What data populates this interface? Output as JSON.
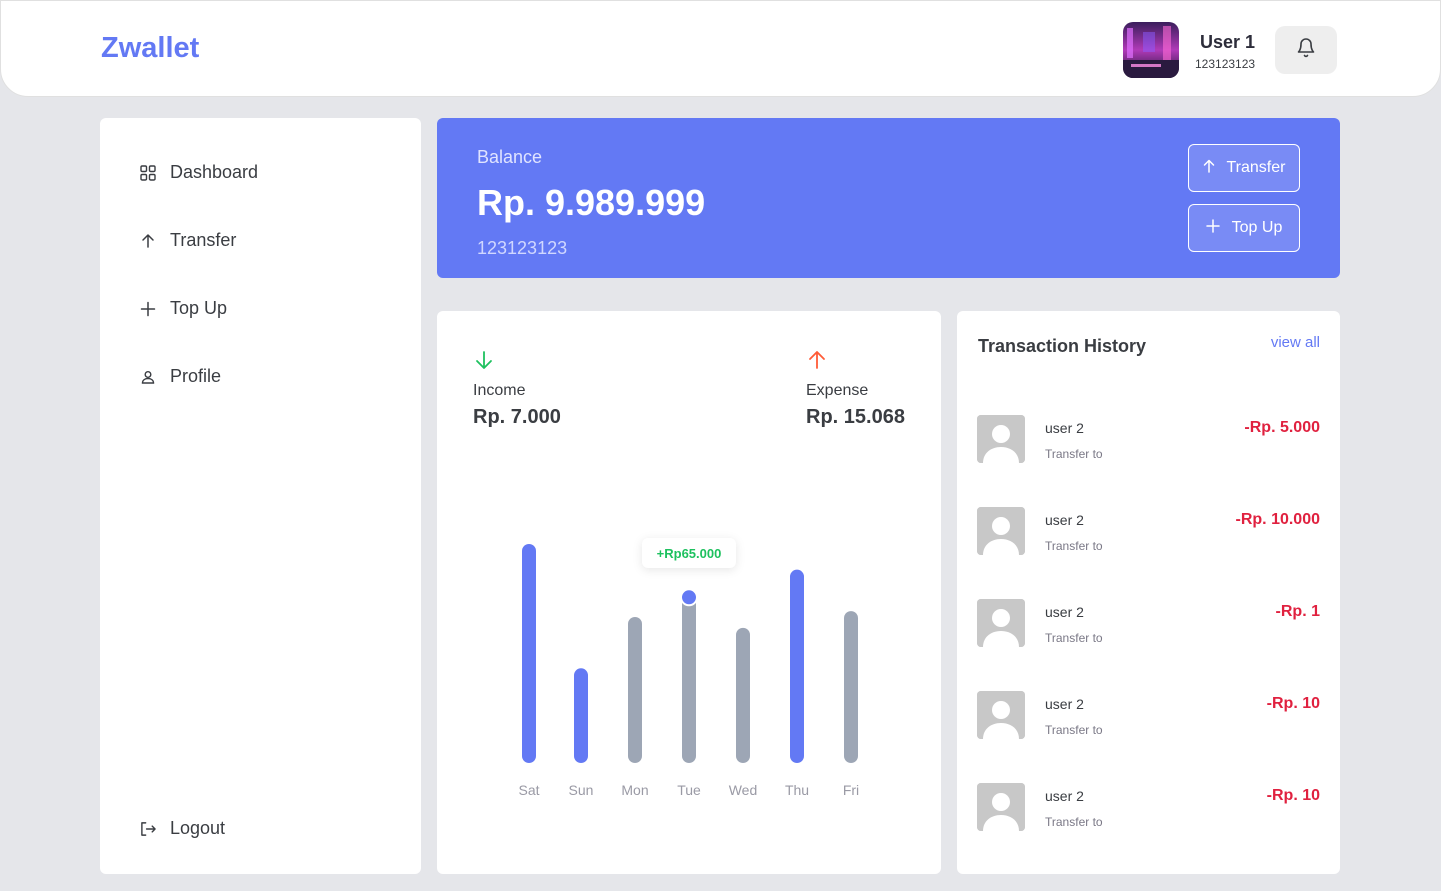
{
  "header": {
    "logo": "Zwallet",
    "user_name": "User 1",
    "user_phone": "123123123"
  },
  "sidebar": {
    "items": [
      {
        "label": "Dashboard",
        "icon": "grid-icon"
      },
      {
        "label": "Transfer",
        "icon": "arrow-up-icon"
      },
      {
        "label": "Top Up",
        "icon": "plus-icon"
      },
      {
        "label": "Profile",
        "icon": "user-icon"
      }
    ],
    "logout_label": "Logout"
  },
  "balance": {
    "label": "Balance",
    "amount": "Rp. 9.989.999",
    "phone": "123123123",
    "transfer_label": "Transfer",
    "topup_label": "Top Up"
  },
  "stats": {
    "income_label": "Income",
    "income_value": "Rp. 7.000",
    "expense_label": "Expense",
    "expense_value": "Rp. 15.068"
  },
  "chart_data": {
    "type": "bar",
    "categories": [
      "Sat",
      "Sun",
      "Mon",
      "Tue",
      "Wed",
      "Thu",
      "Fri"
    ],
    "values": [
      222,
      96,
      148,
      170,
      137,
      196,
      154
    ],
    "highlight": [
      true,
      true,
      false,
      false,
      false,
      true,
      false
    ],
    "tooltip": {
      "category": "Tue",
      "label": "+Rp65.000"
    },
    "colors": {
      "highlight": "#6379f4",
      "default": "#9da6b5"
    }
  },
  "transactions": {
    "title": "Transaction History",
    "view_all": "view all",
    "items": [
      {
        "name": "user 2",
        "type": "Transfer to",
        "amount": "-Rp. 5.000"
      },
      {
        "name": "user 2",
        "type": "Transfer to",
        "amount": "-Rp. 10.000"
      },
      {
        "name": "user 2",
        "type": "Transfer to",
        "amount": "-Rp. 1"
      },
      {
        "name": "user 2",
        "type": "Transfer to",
        "amount": "-Rp. 10"
      },
      {
        "name": "user 2",
        "type": "Transfer to",
        "amount": "-Rp. 10"
      }
    ]
  },
  "colors": {
    "primary": "#6379f4",
    "income": "#1ec15f",
    "expense": "#ff5b37",
    "negative_amount": "#e0213f"
  }
}
